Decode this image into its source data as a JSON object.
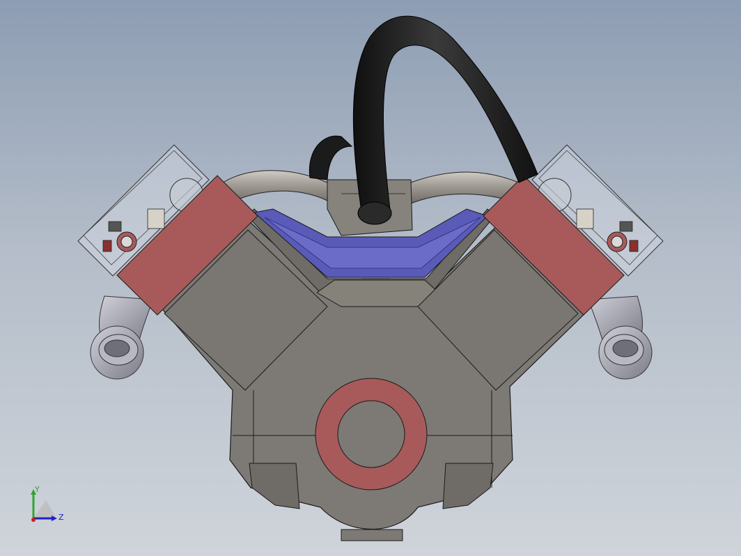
{
  "view": {
    "model": "v-engine-assembly",
    "orientation_triad": {
      "y_label": "Y",
      "z_label": "Z",
      "y_color": "#2fa52f",
      "z_color": "#2020c8",
      "x_color": "#c82020"
    }
  },
  "colors": {
    "background_top": "#8d9db3",
    "background_bottom": "#cfd4da",
    "block": "#7d7a75",
    "cylinder_head": "#a85a5a",
    "intake_channel": "#5a5ab8",
    "hose": "#1e1e1e",
    "exhaust": "#9a9aa6",
    "edge": "#1a1a1a"
  }
}
